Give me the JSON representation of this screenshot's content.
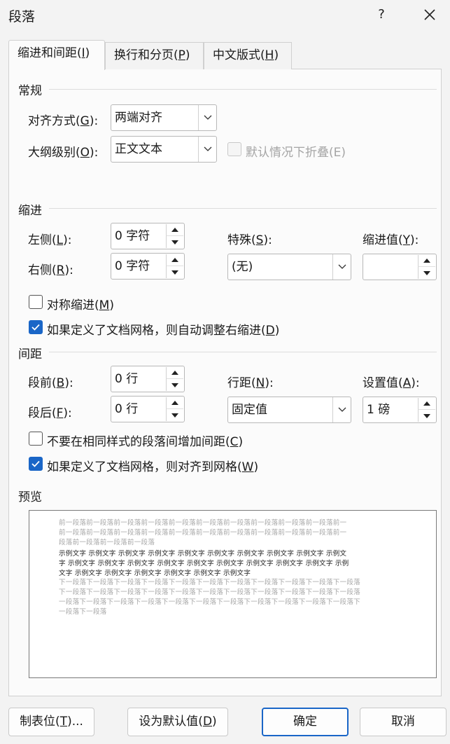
{
  "window": {
    "title": "段落",
    "help_label": "?",
    "close_label": "✕"
  },
  "tabs": [
    {
      "label": "缩进和间距(I)",
      "pre": "缩进和间距(",
      "key": "I",
      "post": ")"
    },
    {
      "label": "换行和分页(P)",
      "pre": "换行和分页(",
      "key": "P",
      "post": ")"
    },
    {
      "label": "中文版式(H)",
      "pre": "中文版式(",
      "key": "H",
      "post": ")"
    }
  ],
  "general": {
    "heading": "常规",
    "alignment": {
      "pre": "对齐方式(",
      "key": "G",
      "post": "):",
      "value": "两端对齐"
    },
    "outline": {
      "pre": "大纲级别(",
      "key": "O",
      "post": "):",
      "value": "正文文本"
    },
    "collapse": {
      "label": "默认情况下折叠(E)",
      "checked": false,
      "enabled": false
    }
  },
  "indent": {
    "heading": "缩进",
    "left": {
      "pre": "左侧(",
      "key": "L",
      "post": "):",
      "value": "0 字符"
    },
    "right": {
      "pre": "右侧(",
      "key": "R",
      "post": "):",
      "value": "0 字符"
    },
    "special": {
      "pre": "特殊(",
      "key": "S",
      "post": "):",
      "value": "(无)"
    },
    "indent_by": {
      "pre": "缩进值(",
      "key": "Y",
      "post": "):",
      "value": ""
    },
    "mirror": {
      "pre": "对称缩进(",
      "key": "M",
      "post": ")",
      "checked": false
    },
    "auto_adjust": {
      "pre": "如果定义了文档网格，则自动调整右缩进(",
      "key": "D",
      "post": ")",
      "checked": true
    }
  },
  "spacing": {
    "heading": "间距",
    "before": {
      "pre": "段前(",
      "key": "B",
      "post": "):",
      "value": "0 行"
    },
    "after": {
      "pre": "段后(",
      "key": "F",
      "post": "):",
      "value": "0 行"
    },
    "line_spacing": {
      "pre": "行距(",
      "key": "N",
      "post": "):",
      "value": "固定值"
    },
    "at": {
      "pre": "设置值(",
      "key": "A",
      "post": "):",
      "value": "1 磅"
    },
    "no_space_same_style": {
      "pre": "不要在相同样式的段落间增加间距(",
      "key": "C",
      "post": ")",
      "checked": false
    },
    "snap_to_grid": {
      "pre": "如果定义了文档网格，则对齐到网格(",
      "key": "W",
      "post": ")",
      "checked": true
    }
  },
  "preview": {
    "heading": "预览",
    "lines": [
      "前一段落前一段落前一段落前一段落前一段落前一段落前一段落前一段落前一段落前一段落前一",
      "前一段落前一段落前一段落前一段落前一段落前一段落前一段落前一段落前一段落前一段落前一",
      "段落前一段落前一段落前一段落",
      "示例文字 示例文字 示例文字 示例文字 示例文字 示例文字 示例文字 示例文字 示例文字 示例文",
      "字 示例文字 示例文字 示例文字 示例文字 示例文字 示例文字 示例文字 示例文字 示例文字 示例",
      "文字 示例文字 示例文字 示例文字 示例文字 示例文字 示例文字",
      "下一段落下一段落下一段落下一段落下一段落下一段落下一段落下一段落下一段落下一段落下一段落",
      "下一段落下一段落下一段落下一段落下一段落下一段落下一段落下一段落下一段落下一段落下一段落",
      "一段落下一段落下一段落下一段落下一段落下一段落下一段落下一段落下一段落下一段落下一段落下",
      "一段落下一段落"
    ]
  },
  "buttons": {
    "tabs": {
      "pre": "制表位(",
      "key": "T",
      "post": ")..."
    },
    "set_default": {
      "pre": "设为默认值(",
      "key": "D",
      "post": ")"
    },
    "ok": {
      "label": "确定"
    },
    "cancel": {
      "label": "取消"
    }
  }
}
